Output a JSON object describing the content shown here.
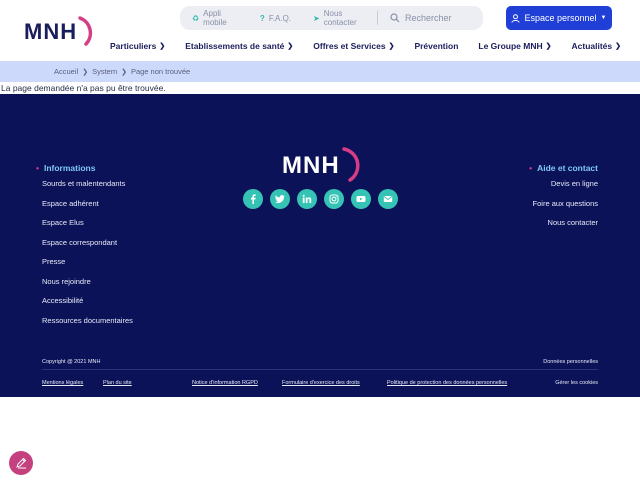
{
  "header": {
    "logo_text": "MNH",
    "utility": {
      "appli_label": "Appli mobile",
      "faq_label": "F.A.Q.",
      "contact_label": "Nous contacter",
      "search_placeholder": "Rechercher"
    },
    "espace_label": "Espace personnel",
    "nav": [
      {
        "label": "Particuliers",
        "has_menu": true
      },
      {
        "label": "Etablissements de santé",
        "has_menu": true
      },
      {
        "label": "Offres et Services",
        "has_menu": true
      },
      {
        "label": "Prévention",
        "has_menu": false
      },
      {
        "label": "Le Groupe MNH",
        "has_menu": true
      },
      {
        "label": "Actualités",
        "has_menu": true
      }
    ]
  },
  "breadcrumb": [
    "Accueil",
    "System",
    "Page non trouvée"
  ],
  "message": "La page demandée n'a pas pu être trouvée.",
  "footer": {
    "logo_text": "MNH",
    "informations": {
      "title": "Informations",
      "links": [
        "Sourds et malentendants",
        "Espace adhérent",
        "Espace Elus",
        "Espace correspondant",
        "Presse",
        "Nous rejoindre",
        "Accessibilité",
        "Ressources documentaires"
      ]
    },
    "aide": {
      "title": "Aide et contact",
      "links": [
        "Devis en ligne",
        "Foire aux questions",
        "Nous contacter"
      ]
    },
    "socials": [
      "facebook-icon",
      "twitter-icon",
      "linkedin-icon",
      "instagram-icon",
      "youtube-icon",
      "email-icon"
    ],
    "copyright": "Copyright @ 2021 MNH",
    "donnees": "Données personnelles",
    "legal": [
      "Mentions légales",
      "Plan du site",
      "Notice d'information RGPD",
      "Formulaire d'exercice des droits",
      "Politique de protection des données personnelles"
    ],
    "cookies": "Gérer les cookies"
  },
  "colors": {
    "footer_bg": "#0b1258",
    "accent_blue": "#1f3fd6",
    "teal": "#35c3b5",
    "pink": "#d53d86",
    "breadcrumb_bg": "#cdd9fb"
  }
}
